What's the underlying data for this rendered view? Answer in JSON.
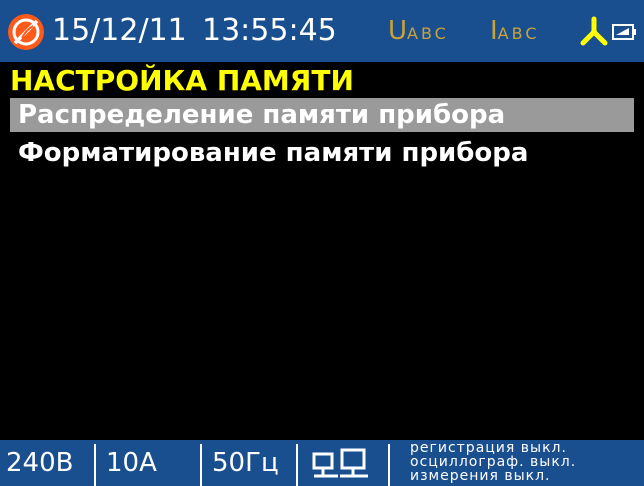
{
  "status_bar": {
    "logo_icon": "no-signal-icon",
    "date": "15/12/11",
    "time": "13:55:45",
    "voltage_indicator": {
      "big": "U",
      "small": "ABC"
    },
    "current_indicator": {
      "big": "I",
      "small": "ABC"
    },
    "phase_icon": "three-phase-star-icon",
    "battery_icon": "battery-icon",
    "colors": {
      "bar_background": "#1a4f8f",
      "indicator": "#c9a23a",
      "phase_icon": "#ffff00",
      "logo": "#ff5a1a"
    }
  },
  "menu": {
    "title": "НАСТРОЙКА ПАМЯТИ",
    "title_color": "#ffff00",
    "selected_index": 0,
    "highlight_color": "#9a9a9a",
    "items": [
      {
        "label": "Распределение памяти прибора"
      },
      {
        "label": "Форматирование памяти прибора"
      }
    ]
  },
  "bottom_bar": {
    "voltage": "240В",
    "current": "10А",
    "frequency": "50Гц",
    "network_icon": "network-computers-icon",
    "status_lines": [
      "регистрация выкл.",
      "осциллограф. выкл.",
      "измерения выкл."
    ]
  }
}
